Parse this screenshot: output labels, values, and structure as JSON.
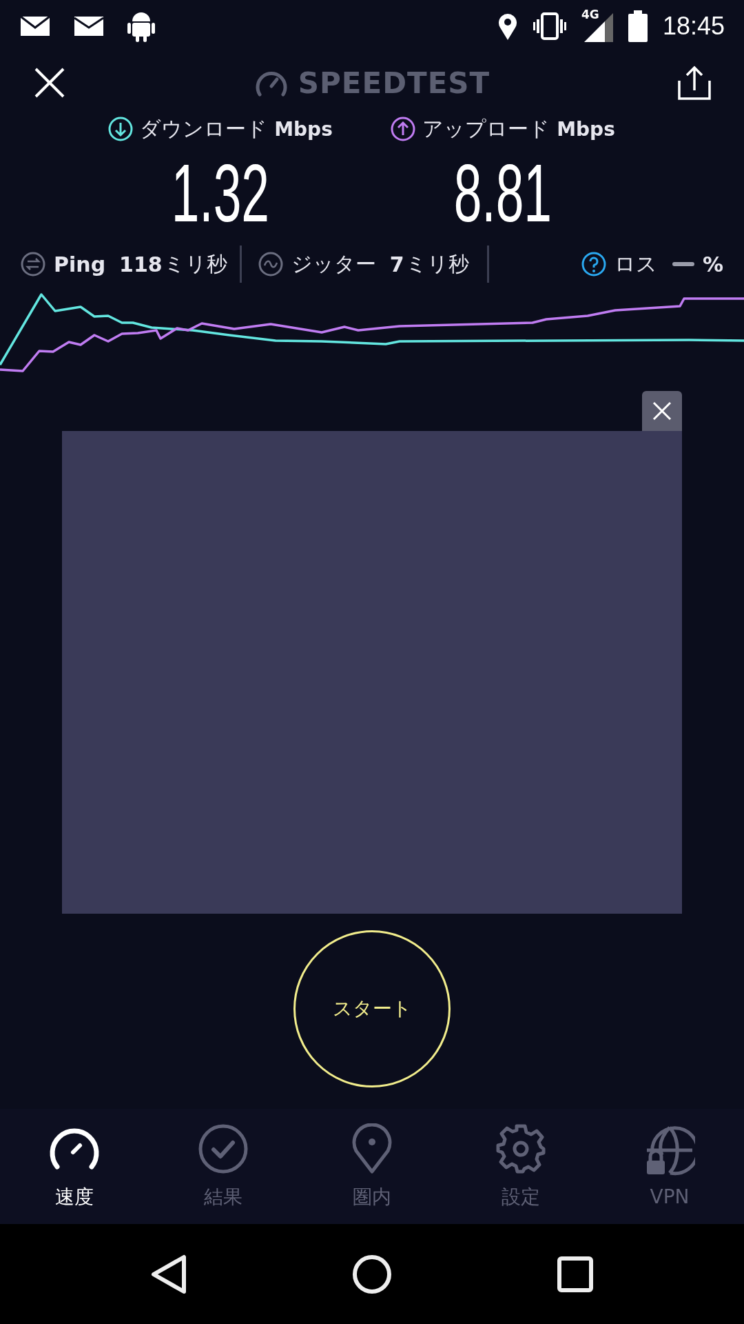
{
  "status_bar": {
    "network": "4G",
    "time": "18:45"
  },
  "header": {
    "title": "SPEEDTEST"
  },
  "results": [
    {
      "kind": "download",
      "label": "ダウンロード",
      "unit": "Mbps",
      "value": "1.32"
    },
    {
      "kind": "upload",
      "label": "アップロード",
      "unit": "Mbps",
      "value": "8.81"
    }
  ],
  "metrics": [
    {
      "kind": "ping",
      "label": "Ping",
      "value": "118",
      "unit": "ミリ秒"
    },
    {
      "kind": "jitter",
      "label": "ジッター",
      "value": "7",
      "unit": "ミリ秒"
    },
    {
      "kind": "loss",
      "label": "ロス",
      "unit": "%"
    }
  ],
  "start_button": {
    "label": "スタート"
  },
  "tabs": [
    {
      "kind": "speed",
      "label": "速度",
      "selected": true
    },
    {
      "kind": "results",
      "label": "結果",
      "selected": false
    },
    {
      "kind": "coverage",
      "label": "圏内",
      "selected": false
    },
    {
      "kind": "settings",
      "label": "設定",
      "selected": false
    },
    {
      "kind": "vpn",
      "label": "VPN",
      "selected": false
    }
  ]
}
